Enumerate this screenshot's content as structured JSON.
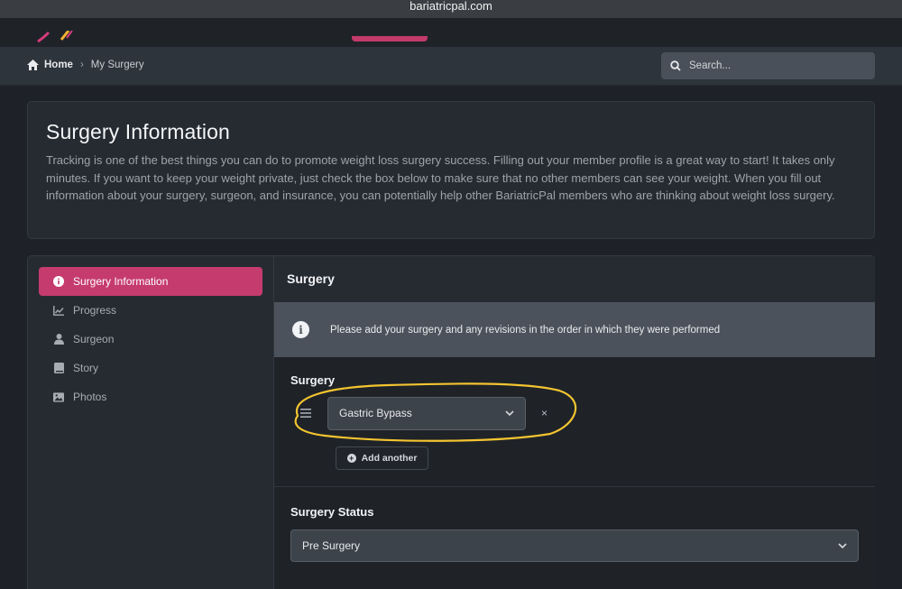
{
  "browser": {
    "url": "bariatricpal.com"
  },
  "breadcrumb": {
    "home": "Home",
    "current": "My Surgery"
  },
  "search": {
    "placeholder": "Search..."
  },
  "intro": {
    "title": "Surgery Information",
    "body": "Tracking is one of the best things you can do to promote weight loss surgery success. Filling out your member profile is a great way to start! It takes only minutes. If you want to keep your weight private, just check the box below to make sure that no other members can see your weight. When you fill out information about your surgery, surgeon, and insurance, you can potentially help other BariatricPal members who are thinking about weight loss surgery."
  },
  "sidebar": {
    "items": [
      {
        "label": "Surgery Information",
        "icon": "info-icon",
        "active": true
      },
      {
        "label": "Progress",
        "icon": "chart-icon",
        "active": false
      },
      {
        "label": "Surgeon",
        "icon": "user-icon",
        "active": false
      },
      {
        "label": "Story",
        "icon": "book-icon",
        "active": false
      },
      {
        "label": "Photos",
        "icon": "image-icon",
        "active": false
      }
    ]
  },
  "main": {
    "header": "Surgery",
    "notice": "Please add your surgery and any revisions in the order in which they were performed",
    "surgery_label": "Surgery",
    "surgery_value": "Gastric Bypass",
    "remove_label": "×",
    "add_label": "Add another",
    "status_label": "Surgery Status",
    "status_value": "Pre Surgery"
  },
  "colors": {
    "accent": "#c53b6d",
    "highlight": "#f4c430"
  }
}
